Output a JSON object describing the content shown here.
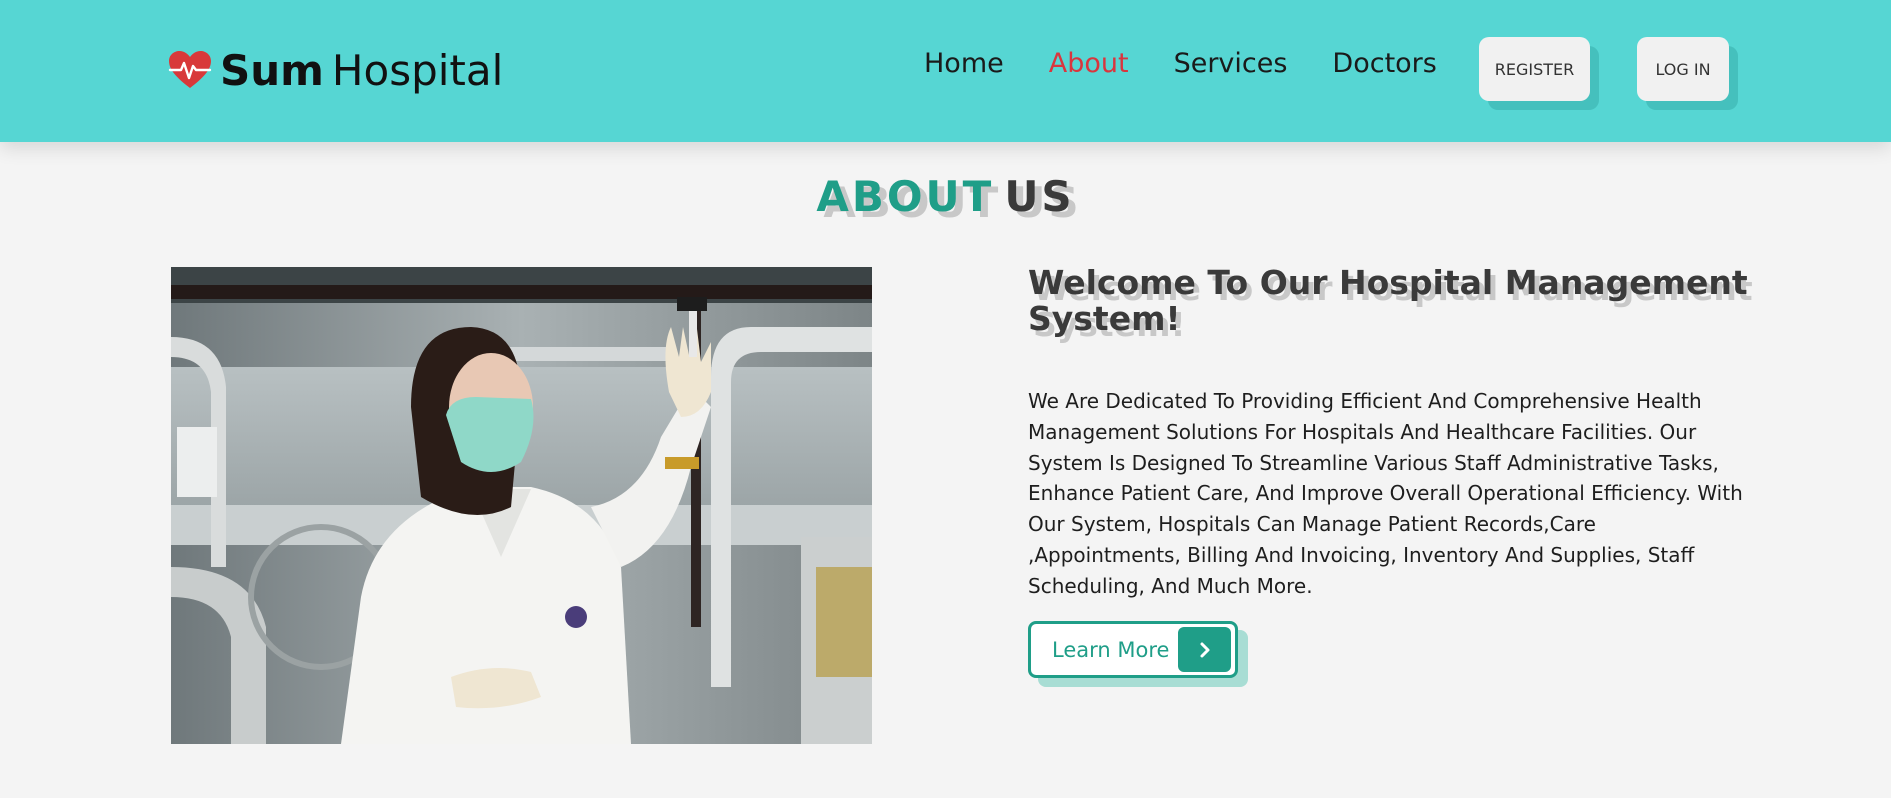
{
  "header": {
    "logo_bold": "Sum",
    "logo_light": "Hospital",
    "nav": [
      "Home",
      "About",
      "Services",
      "Doctors"
    ],
    "active_nav": "About",
    "register_label": "REGISTER",
    "login_label": "LOG IN"
  },
  "about": {
    "title_part1": "ABOUT",
    "title_part2": "US",
    "heading": "Welcome To Our Hospital Management System!",
    "description": "We Are Dedicated To Providing Efficient And Comprehensive Health Management Solutions For Hospitals And Healthcare Facilities. Our System Is Designed To Streamline Various Staff Administrative Tasks, Enhance Patient Care, And Improve Overall Operational Efficiency. With Our System, Hospitals Can Manage Patient Records,Care ,Appointments, Billing And Invoicing, Inventory And Supplies, Staff Scheduling, And Much More.",
    "button_label": "Learn More"
  },
  "icons": {
    "logo_icon": "heart-pulse-icon",
    "button_icon": "chevron-right-icon"
  },
  "colors": {
    "header_bg": "#56d6d3",
    "accent_teal": "#1f9e88",
    "active_red": "#d9363e",
    "heart_red": "#d8393a",
    "page_bg": "#f4f4f4"
  }
}
